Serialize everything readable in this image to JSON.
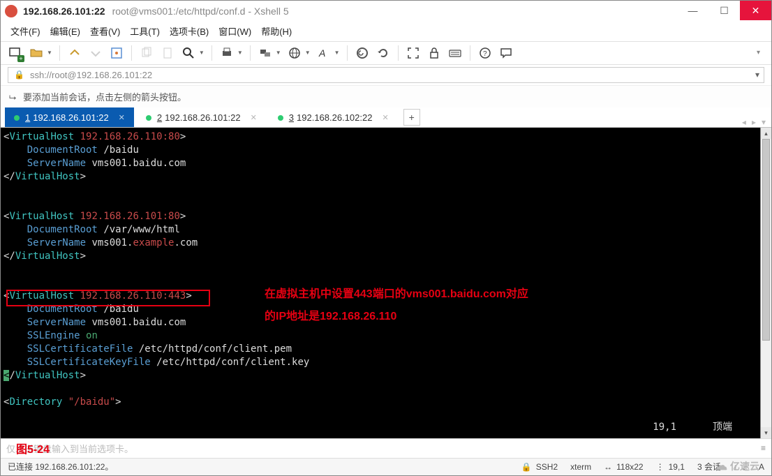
{
  "window": {
    "ip": "192.168.26.101:22",
    "path": "root@vms001:/etc/httpd/conf.d - Xshell 5"
  },
  "menu": {
    "file": "文件(F)",
    "edit": "编辑(E)",
    "view": "查看(V)",
    "tool": "工具(T)",
    "tab": "选项卡(B)",
    "window": "窗口(W)",
    "help": "帮助(H)"
  },
  "address": {
    "url": "ssh://root@192.168.26.101:22"
  },
  "hint": {
    "text": "要添加当前会话，点击左侧的箭头按钮。"
  },
  "tabs": [
    {
      "num": "1",
      "label": "192.168.26.101:22",
      "active": true
    },
    {
      "num": "2",
      "label": "192.168.26.101:22",
      "active": false
    },
    {
      "num": "3",
      "label": "192.168.26.102:22",
      "active": false
    }
  ],
  "terminal": {
    "vhost1_open": "VirtualHost",
    "vhost1_addr": "192.168.26.110:80",
    "docroot": "DocumentRoot",
    "vhost1_root": "/baidu",
    "sname": "ServerName",
    "vhost1_sname": "vms001.baidu.com",
    "vhost_close": "VirtualHost",
    "vhost2_addr": "192.168.26.101:80",
    "vhost2_root": "/var/www/html",
    "vhost2_sname_a": "vms001.",
    "vhost2_sname_b": "example",
    "vhost2_sname_c": ".com",
    "vhost3_addr": "192.168.26.110:443",
    "vhost3_root": "/baidu",
    "vhost3_sname": "vms001.baidu.com",
    "sslengine": "SSLEngine",
    "on": "on",
    "sslcert": "SSLCertificateFile",
    "sslcert_path": "/etc/httpd/conf/client.pem",
    "sslkey": "SSLCertificateKeyFile",
    "sslkey_path": "/etc/httpd/conf/client.key",
    "directory": "Directory",
    "dir_path": "\"/baidu\"",
    "pos": "19,1",
    "mode": "顶端"
  },
  "annotation": {
    "line1": "在虚拟主机中设置443端口的vms001.baidu.com对应",
    "line2": "的IP地址是192.168.26.110",
    "fig": "图5-24"
  },
  "inputrow": {
    "placeholder": "仅发送键盘输入到当前选项卡。"
  },
  "status": {
    "connected": "已连接 192.168.26.101:22。",
    "proto": "SSH2",
    "term": "xterm",
    "size": "118x22",
    "cursor": "19,1",
    "sessions": "3 会话"
  },
  "watermark": "亿速云"
}
